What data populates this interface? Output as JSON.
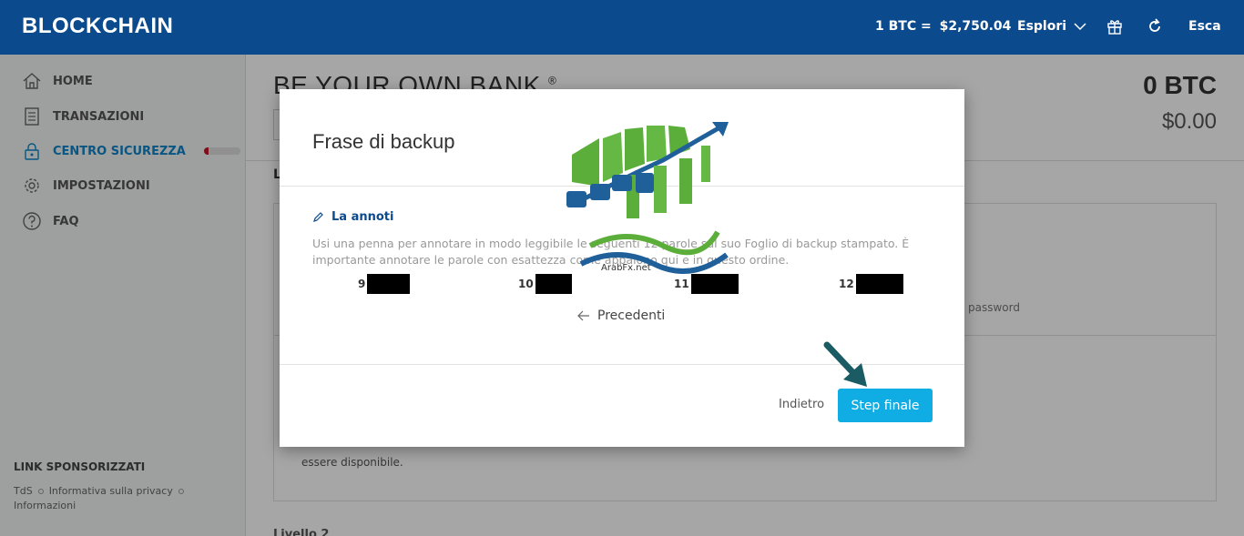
{
  "header": {
    "brand": "BLOCKCHAIN",
    "rate_label": "1 BTC =",
    "rate_value": "$2,750.04",
    "explore_label": "Esplori",
    "logout_label": "Esca"
  },
  "sidebar": {
    "items": [
      {
        "label": "HOME",
        "icon": "home-icon"
      },
      {
        "label": "TRANSAZIONI",
        "icon": "document-icon"
      },
      {
        "label": "CENTRO SICUREZZA",
        "icon": "lock-icon"
      },
      {
        "label": "IMPOSTAZIONI",
        "icon": "gear-icon"
      },
      {
        "label": "FAQ",
        "icon": "help-icon"
      }
    ],
    "security_progress": 0.12,
    "sponsored_title": "LINK SPONSORIZZATI",
    "footer_links": [
      "TdS",
      "Informativa sulla privacy",
      "Informazioni"
    ]
  },
  "main": {
    "title": "BE YOUR OWN BANK",
    "title_mark": "®",
    "balance_btc": "0 BTC",
    "balance_fiat": "$0.00",
    "bg_l": "L",
    "bg_text_password": "password",
    "bg_text_available": "essere disponibile.",
    "bg_text_level": "Livello 2"
  },
  "modal": {
    "title": "Frase di backup",
    "write_heading": "La annoti",
    "instructions": "Usi una penna per annotare in modo leggibile le seguenti 12 parole sul suo Foglio di backup stampato. È importante annotare le parole con esattezza come appaiono qui e in questo ordine.",
    "words": [
      {
        "index": "9"
      },
      {
        "index": "10"
      },
      {
        "index": "11"
      },
      {
        "index": "12"
      }
    ],
    "previous_label": "Precedenti",
    "back_label": "Indietro",
    "next_label": "Step finale"
  },
  "watermark": {
    "text": "ArabFx.net"
  },
  "colors": {
    "header_bg": "#0b4b8d",
    "accent": "#0b84c9",
    "primary_button": "#10ade4",
    "security_danger": "#c4162a"
  }
}
